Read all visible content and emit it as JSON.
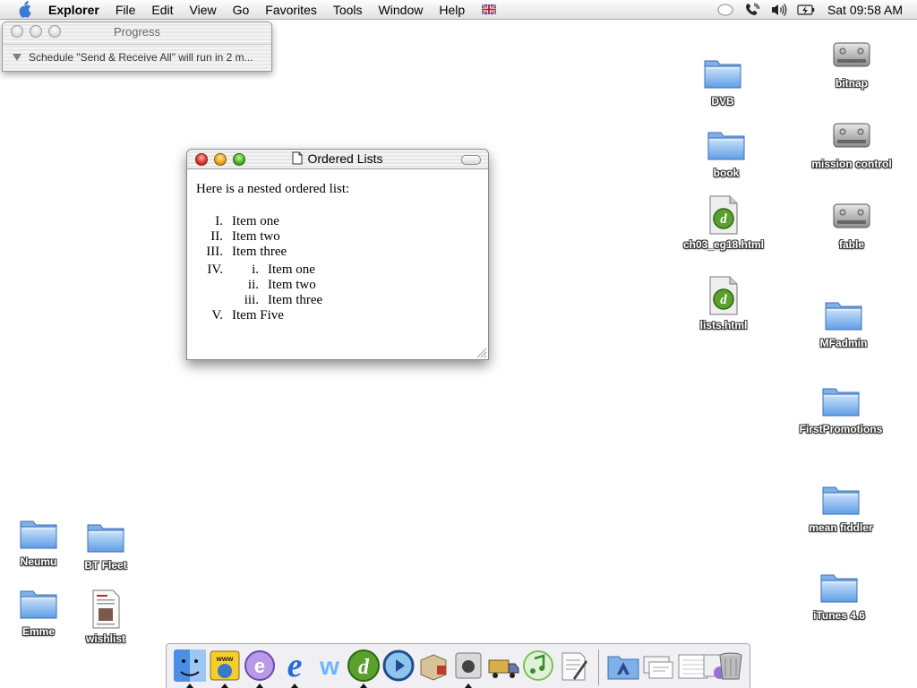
{
  "menubar": {
    "app_name": "Explorer",
    "items": [
      "File",
      "Edit",
      "View",
      "Go",
      "Favorites",
      "Tools",
      "Window",
      "Help"
    ],
    "clock": "Sat 09:58 AM",
    "status_icons": [
      "speech-icon",
      "phone-icon",
      "volume-icon",
      "battery-icon"
    ]
  },
  "progress_window": {
    "title": "Progress",
    "message": "Schedule \"Send & Receive All\" will run in 2 m..."
  },
  "browser_window": {
    "title": "Ordered Lists",
    "intro": "Here is a nested ordered list:",
    "list": [
      {
        "num": "I.",
        "text": "Item one"
      },
      {
        "num": "II.",
        "text": "Item two"
      },
      {
        "num": "III.",
        "text": "Item three"
      },
      {
        "num": "IV.",
        "text": "",
        "children": [
          {
            "num": "i.",
            "text": "Item one"
          },
          {
            "num": "ii.",
            "text": "Item two"
          },
          {
            "num": "iii.",
            "text": "Item three"
          }
        ]
      },
      {
        "num": "V.",
        "text": "Item Five"
      }
    ]
  },
  "desktop_icons": [
    {
      "label": "DVB",
      "type": "folder"
    },
    {
      "label": "book",
      "type": "folder"
    },
    {
      "label": "ch03_eg18.html",
      "type": "dw-file"
    },
    {
      "label": "lists.html",
      "type": "dw-file"
    },
    {
      "label": "bitnap",
      "type": "disk"
    },
    {
      "label": "mission control",
      "type": "disk"
    },
    {
      "label": "fable",
      "type": "disk"
    },
    {
      "label": "MFadmin",
      "type": "folder"
    },
    {
      "label": "FirstPromotions",
      "type": "folder"
    },
    {
      "label": "mean fiddler",
      "type": "folder"
    },
    {
      "label": "iTunes 4.6",
      "type": "folder"
    },
    {
      "label": "Neumu",
      "type": "alias-folder"
    },
    {
      "label": "BT Fleet",
      "type": "folder"
    },
    {
      "label": "Emme",
      "type": "folder"
    },
    {
      "label": "wishlist",
      "type": "document"
    }
  ],
  "dock": {
    "items": [
      "finder",
      "internet-explorer-www",
      "edge-app",
      "internet-explorer",
      "word",
      "dreamweaver",
      "quicktime",
      "installer",
      "apple-system",
      "mail-truck",
      "itunes",
      "textedit",
      "applications-folder",
      "documents",
      "screenshots",
      "browser-doc",
      "trash"
    ]
  }
}
